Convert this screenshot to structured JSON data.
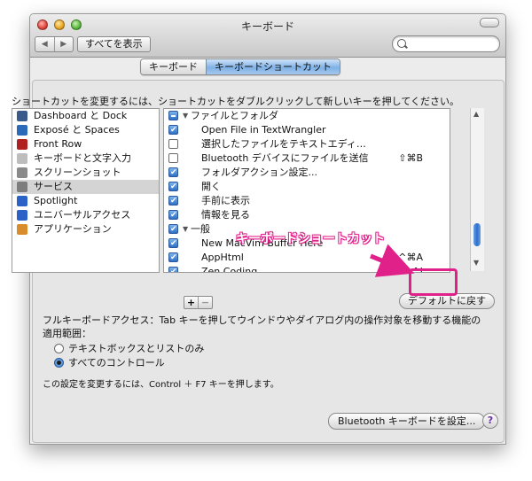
{
  "window": {
    "title": "キーボード"
  },
  "toolbar": {
    "back": "◀",
    "forward": "▶",
    "show_all": "すべてを表示",
    "search_placeholder": ""
  },
  "tabs": [
    {
      "label": "キーボード"
    },
    {
      "label": "キーボードショートカット",
      "active": true
    }
  ],
  "instruction": "ショートカットを変更するには、ショートカットをダブルクリックして新しいキーを押してください。",
  "categories": [
    {
      "label": "Dashboard と Dock",
      "icon": "dashboard-dock-icon",
      "color": "#3a5a8c"
    },
    {
      "label": "Exposé と Spaces",
      "icon": "expose-spaces-icon",
      "color": "#2a6ab8"
    },
    {
      "label": "Front Row",
      "icon": "front-row-icon",
      "color": "#b02020"
    },
    {
      "label": "キーボードと文字入力",
      "icon": "keyboard-icon",
      "color": "#bdbdbd"
    },
    {
      "label": "スクリーンショット",
      "icon": "screenshot-icon",
      "color": "#8a8a8a"
    },
    {
      "label": "サービス",
      "icon": "services-gear-icon",
      "color": "#7d7d7d",
      "selected": true
    },
    {
      "label": "Spotlight",
      "icon": "spotlight-icon",
      "color": "#2a62c8"
    },
    {
      "label": "ユニバーサルアクセス",
      "icon": "universal-access-icon",
      "color": "#2a62c8"
    },
    {
      "label": "アプリケーション",
      "icon": "applications-icon",
      "color": "#d98c2a"
    }
  ],
  "shortcuts": [
    {
      "type": "group",
      "label": "ファイルとフォルダ",
      "state": "mixed"
    },
    {
      "type": "item",
      "label": "Open File in TextWrangler",
      "checked": true,
      "key": ""
    },
    {
      "type": "item",
      "label": "選択したファイルをテキストエディ…",
      "checked": false,
      "key": ""
    },
    {
      "type": "item",
      "label": "Bluetooth デバイスにファイルを送信",
      "checked": false,
      "key": "⇧⌘B"
    },
    {
      "type": "item",
      "label": "フォルダアクション設定...",
      "checked": true,
      "key": ""
    },
    {
      "type": "item",
      "label": "開く",
      "checked": true,
      "key": ""
    },
    {
      "type": "item",
      "label": "手前に表示",
      "checked": true,
      "key": ""
    },
    {
      "type": "item",
      "label": "情報を見る",
      "checked": true,
      "key": ""
    },
    {
      "type": "group",
      "label": "一般",
      "state": "on"
    },
    {
      "type": "item",
      "label": "New MacVim Buffer Here",
      "checked": true,
      "key": ""
    },
    {
      "type": "item",
      "label": "AppHtml",
      "checked": true,
      "key": "^⌘A"
    },
    {
      "type": "item",
      "label": "Zen Coding",
      "checked": true,
      "key": "^I"
    }
  ],
  "list_controls": {
    "plus": "+",
    "minus": "−"
  },
  "defaults_button": "デフォルトに戻す",
  "full_keyboard_access": "フルキーボードアクセス：Tab キーを押してウインドウやダイアログ内の操作対象を移動する機能の適用範囲：",
  "radios": [
    {
      "label": "テキストボックスとリストのみ",
      "selected": false
    },
    {
      "label": "すべてのコントロール",
      "selected": true
    }
  ],
  "note": "この設定を変更するには、Control ＋ F7 キーを押します。",
  "bluetooth_button": "Bluetooth キーボードを設定...",
  "help_label": "?",
  "annotation": {
    "text": "キーボードショートカット",
    "color": "#e0218a"
  }
}
